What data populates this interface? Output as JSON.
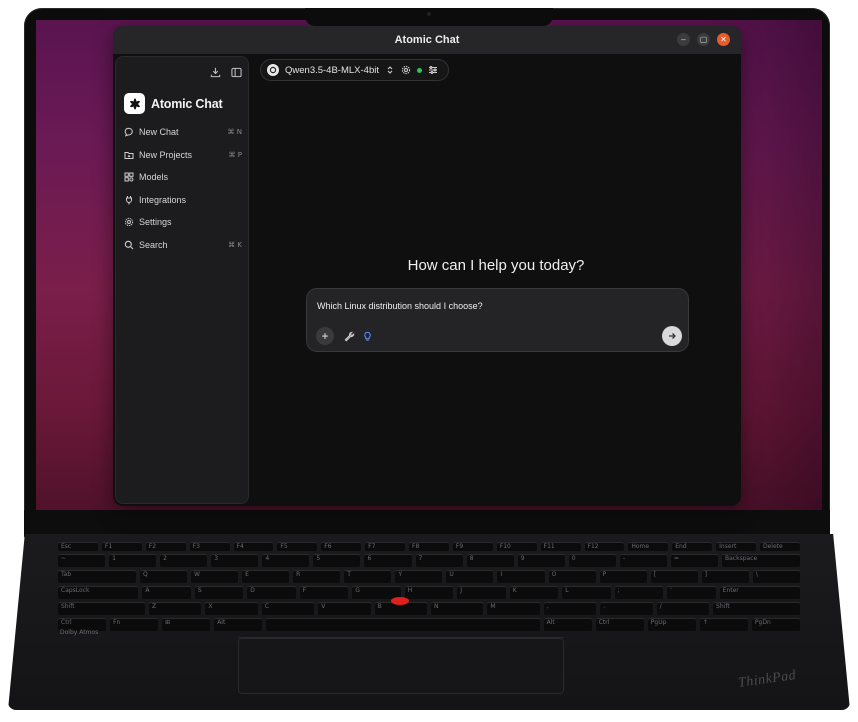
{
  "window": {
    "title": "Atomic Chat",
    "controls": {
      "minimize": "–",
      "maximize": "▢",
      "close": "✕"
    }
  },
  "sidebar": {
    "app_name": "Atomic Chat",
    "top_icons": [
      "download-icon",
      "sidebar-toggle-icon"
    ],
    "items": [
      {
        "label": "New Chat",
        "icon": "chat-bubble-icon",
        "shortcut": "⌘ N"
      },
      {
        "label": "New Projects",
        "icon": "folder-plus-icon",
        "shortcut": "⌘ P"
      },
      {
        "label": "Models",
        "icon": "models-icon",
        "shortcut": ""
      },
      {
        "label": "Integrations",
        "icon": "plug-icon",
        "shortcut": ""
      },
      {
        "label": "Settings",
        "icon": "gear-icon",
        "shortcut": ""
      },
      {
        "label": "Search",
        "icon": "search-icon",
        "shortcut": "⌘ K"
      }
    ]
  },
  "model_selector": {
    "name": "Qwen3.5-4B-MLX-4bit",
    "status_color": "#2ec25b"
  },
  "main": {
    "greeting": "How can I help you today?",
    "composer": {
      "value": "Which Linux distribution should I choose?",
      "add_label": "+"
    }
  },
  "colors": {
    "accent_close": "#e75c2c",
    "app_bg": "#0f0f10",
    "sidebar_bg": "#1c1c1e",
    "wallpaper_top": "#5a1450",
    "wallpaper_bottom": "#50122b",
    "trackpoint": "#e0201c"
  },
  "keyboard": {
    "rows": [
      [
        "Esc",
        "F1",
        "F2",
        "F3",
        "F4",
        "F5",
        "F6",
        "F7",
        "F8",
        "F9",
        "F10",
        "F11",
        "F12",
        "Home",
        "End",
        "Insert",
        "Delete"
      ],
      [
        "~",
        "1",
        "2",
        "3",
        "4",
        "5",
        "6",
        "7",
        "8",
        "9",
        "0",
        "-",
        "=",
        "Backspace"
      ],
      [
        "Tab",
        "Q",
        "W",
        "E",
        "R",
        "T",
        "Y",
        "U",
        "I",
        "O",
        "P",
        "[",
        "]",
        "\\"
      ],
      [
        "CapsLock",
        "A",
        "S",
        "D",
        "F",
        "G",
        "H",
        "J",
        "K",
        "L",
        ";",
        "'",
        "Enter"
      ],
      [
        "Shift",
        "Z",
        "X",
        "C",
        "V",
        "B",
        "N",
        "M",
        ",",
        ".",
        "/",
        "Shift"
      ],
      [
        "Ctrl",
        "Fn",
        "⊞",
        "Alt",
        "",
        "Alt",
        "Ctrl",
        "PgUp",
        "↑",
        "PgDn"
      ]
    ],
    "brand": "ThinkPad",
    "audio": "Dolby Atmos"
  }
}
